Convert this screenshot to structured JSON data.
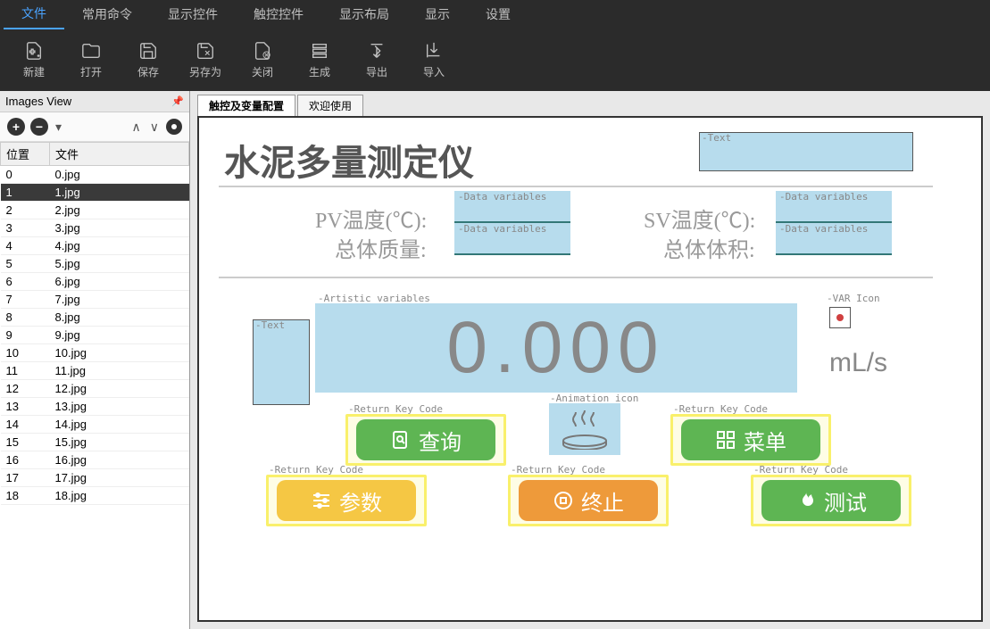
{
  "menu": {
    "items": [
      "文件",
      "常用命令",
      "显示控件",
      "触控控件",
      "显示布局",
      "显示",
      "设置"
    ],
    "active_index": 0
  },
  "toolbar": {
    "buttons": [
      {
        "label": "新建",
        "icon": "new"
      },
      {
        "label": "打开",
        "icon": "open"
      },
      {
        "label": "保存",
        "icon": "save"
      },
      {
        "label": "另存为",
        "icon": "saveas"
      },
      {
        "label": "关闭",
        "icon": "close"
      },
      {
        "label": "生成",
        "icon": "build"
      },
      {
        "label": "导出",
        "icon": "export"
      },
      {
        "label": "导入",
        "icon": "import"
      }
    ]
  },
  "left_panel": {
    "title": "Images View",
    "columns": {
      "pos": "位置",
      "file": "文件"
    },
    "rows": [
      {
        "pos": "0",
        "file": "0.jpg"
      },
      {
        "pos": "1",
        "file": "1.jpg"
      },
      {
        "pos": "2",
        "file": "2.jpg"
      },
      {
        "pos": "3",
        "file": "3.jpg"
      },
      {
        "pos": "4",
        "file": "4.jpg"
      },
      {
        "pos": "5",
        "file": "5.jpg"
      },
      {
        "pos": "6",
        "file": "6.jpg"
      },
      {
        "pos": "7",
        "file": "7.jpg"
      },
      {
        "pos": "8",
        "file": "8.jpg"
      },
      {
        "pos": "9",
        "file": "9.jpg"
      },
      {
        "pos": "10",
        "file": "10.jpg"
      },
      {
        "pos": "11",
        "file": "11.jpg"
      },
      {
        "pos": "12",
        "file": "12.jpg"
      },
      {
        "pos": "13",
        "file": "13.jpg"
      },
      {
        "pos": "14",
        "file": "14.jpg"
      },
      {
        "pos": "15",
        "file": "15.jpg"
      },
      {
        "pos": "16",
        "file": "16.jpg"
      },
      {
        "pos": "17",
        "file": "17.jpg"
      },
      {
        "pos": "18",
        "file": "18.jpg"
      }
    ],
    "selected_index": 1
  },
  "tabs": {
    "items": [
      "触控及变量配置",
      "欢迎使用"
    ],
    "active_index": 0
  },
  "hmi": {
    "title": "水泥多量测定仪",
    "pv_label": "PV温度(℃):",
    "sv_label": "SV温度(℃):",
    "mass_label": "总体质量:",
    "volume_label": "总体体积:",
    "big_value": "0.000",
    "unit": "mL/s",
    "annotations": {
      "text": "-Text",
      "data_var": "-Data variables",
      "artistic": "-Artistic variables",
      "var_icon": "-VAR Icon",
      "anim_icon": "-Animation icon",
      "return_key": "-Return Key Code"
    },
    "buttons": {
      "query": "查询",
      "menu": "菜单",
      "params": "参数",
      "stop": "终止",
      "test": "测试"
    }
  }
}
